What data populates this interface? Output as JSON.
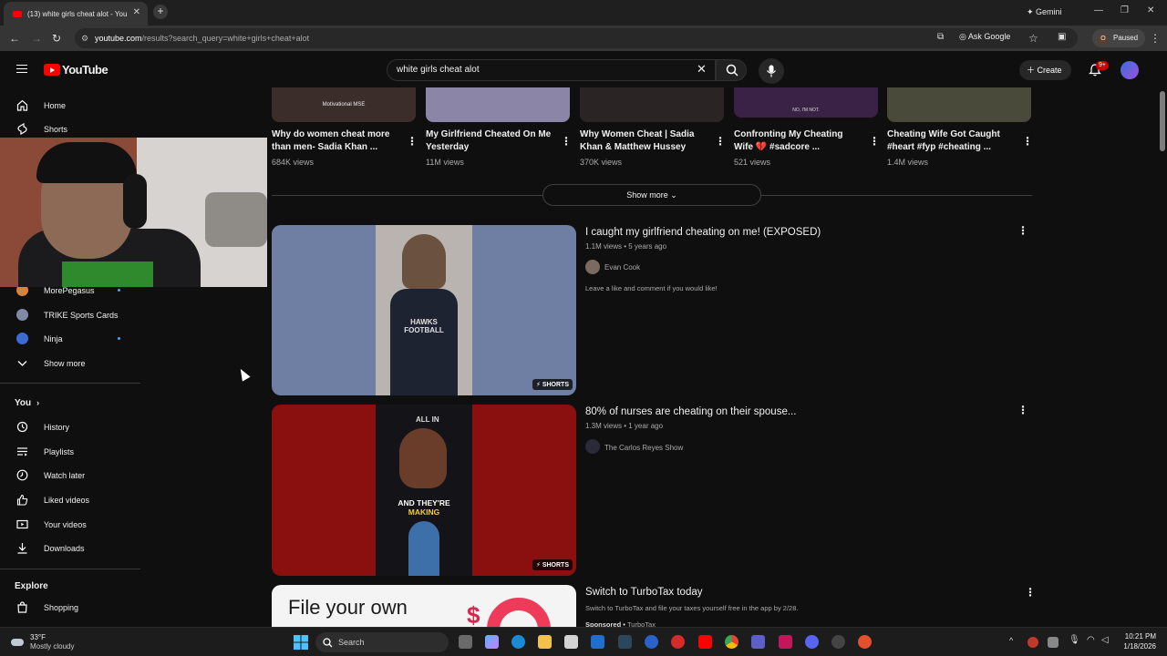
{
  "browser": {
    "tab_title": "(13) white girls cheat alot - You",
    "new_tab_symbol": "+",
    "gemini_label": "Gemini",
    "url_host": "youtube.com",
    "url_path": "/results?search_query=white+girls+cheat+alot",
    "ask_google_label": "Ask Google",
    "profile_initial": "O",
    "paused_label": "Paused"
  },
  "youtube": {
    "logo_text": "YouTube",
    "search_value": "white girls cheat alot",
    "create_label": "Create",
    "notification_badge": "9+"
  },
  "sidebar": {
    "top_items": [
      {
        "label": "Home",
        "icon": "home-icon"
      },
      {
        "label": "Shorts",
        "icon": "shorts-icon"
      }
    ],
    "subscriptions": [
      {
        "label": "MorePegasus",
        "color": "#d9823c",
        "live_dot": true
      },
      {
        "label": "TRIKE Sports Cards",
        "color": "#7f8aa6",
        "live_dot": false
      },
      {
        "label": "Ninja",
        "color": "#3a6bd1",
        "live_dot": true
      }
    ],
    "show_more_label": "Show more",
    "you_title": "You",
    "you_items": [
      {
        "label": "History",
        "icon": "history-icon"
      },
      {
        "label": "Playlists",
        "icon": "playlists-icon"
      },
      {
        "label": "Watch later",
        "icon": "watch-later-icon"
      },
      {
        "label": "Liked videos",
        "icon": "thumbs-up-icon"
      },
      {
        "label": "Your videos",
        "icon": "your-videos-icon"
      },
      {
        "label": "Downloads",
        "icon": "download-icon"
      }
    ],
    "explore_title": "Explore",
    "explore_items": [
      {
        "label": "Shopping",
        "icon": "shopping-icon"
      }
    ]
  },
  "shorts_row": [
    {
      "title": "Why do women cheat more than men- Sadia Khan ...",
      "views": "684K views",
      "thumb_text": "Motivational MSE",
      "thumb_color": "#3b2d2a"
    },
    {
      "title": "My Girlfriend Cheated On Me Yesterday",
      "views": "11M views",
      "thumb_text": "",
      "thumb_color": "#8b86a8"
    },
    {
      "title": "Why Women Cheat | Sadia Khan & Matthew Hussey",
      "views": "370K views",
      "thumb_text": "",
      "thumb_color": "#2a2424"
    },
    {
      "title": "Confronting My Cheating Wife 💔 #sadcore ...",
      "views": "521 views",
      "thumb_text": "NO, I'M NOT.",
      "thumb_color": "#3a2146"
    },
    {
      "title": "Cheating Wife Got Caught #heart #fyp #cheating ...",
      "views": "1.4M views",
      "thumb_text": "",
      "thumb_color": "#4a4a3a"
    }
  ],
  "show_more_label": "Show more",
  "results": [
    {
      "title": "I caught my girlfriend cheating on me! (EXPOSED)",
      "meta": "1.1M views • 5 years ago",
      "channel": "Evan Cook",
      "description": "Leave a like and comment if you would like!",
      "badge": "SHORTS",
      "thumb_bg": "#6f7fa4",
      "thumb_inner": "#b9b4b0",
      "shirt_text": "HAWKS FOOTBALL"
    },
    {
      "title": "80% of nurses are cheating on their spouse...",
      "meta": "1.3M views • 1 year ago",
      "channel": "The Carlos Reyes Show",
      "description": "",
      "badge": "SHORTS",
      "thumb_bg": "#8a1010",
      "thumb_inner": "#141418",
      "overlay_text_1": "AND THEY'RE",
      "overlay_text_2": "MAKING",
      "top_text": "ALL IN"
    },
    {
      "title": "Switch to TurboTax today",
      "meta": "",
      "channel": "",
      "description": "Switch to TurboTax and file your taxes yourself free in the app by 2/28.",
      "sponsored": "Sponsored",
      "sponsor_name": "TurboTax",
      "thumb_text": "File your own",
      "thumb_bg": "#f4f4f4"
    }
  ],
  "taskbar": {
    "temperature": "33°F",
    "weather": "Mostly cloudy",
    "search_placeholder": "Search",
    "time": "10:21 PM",
    "date": "1/18/2026"
  }
}
